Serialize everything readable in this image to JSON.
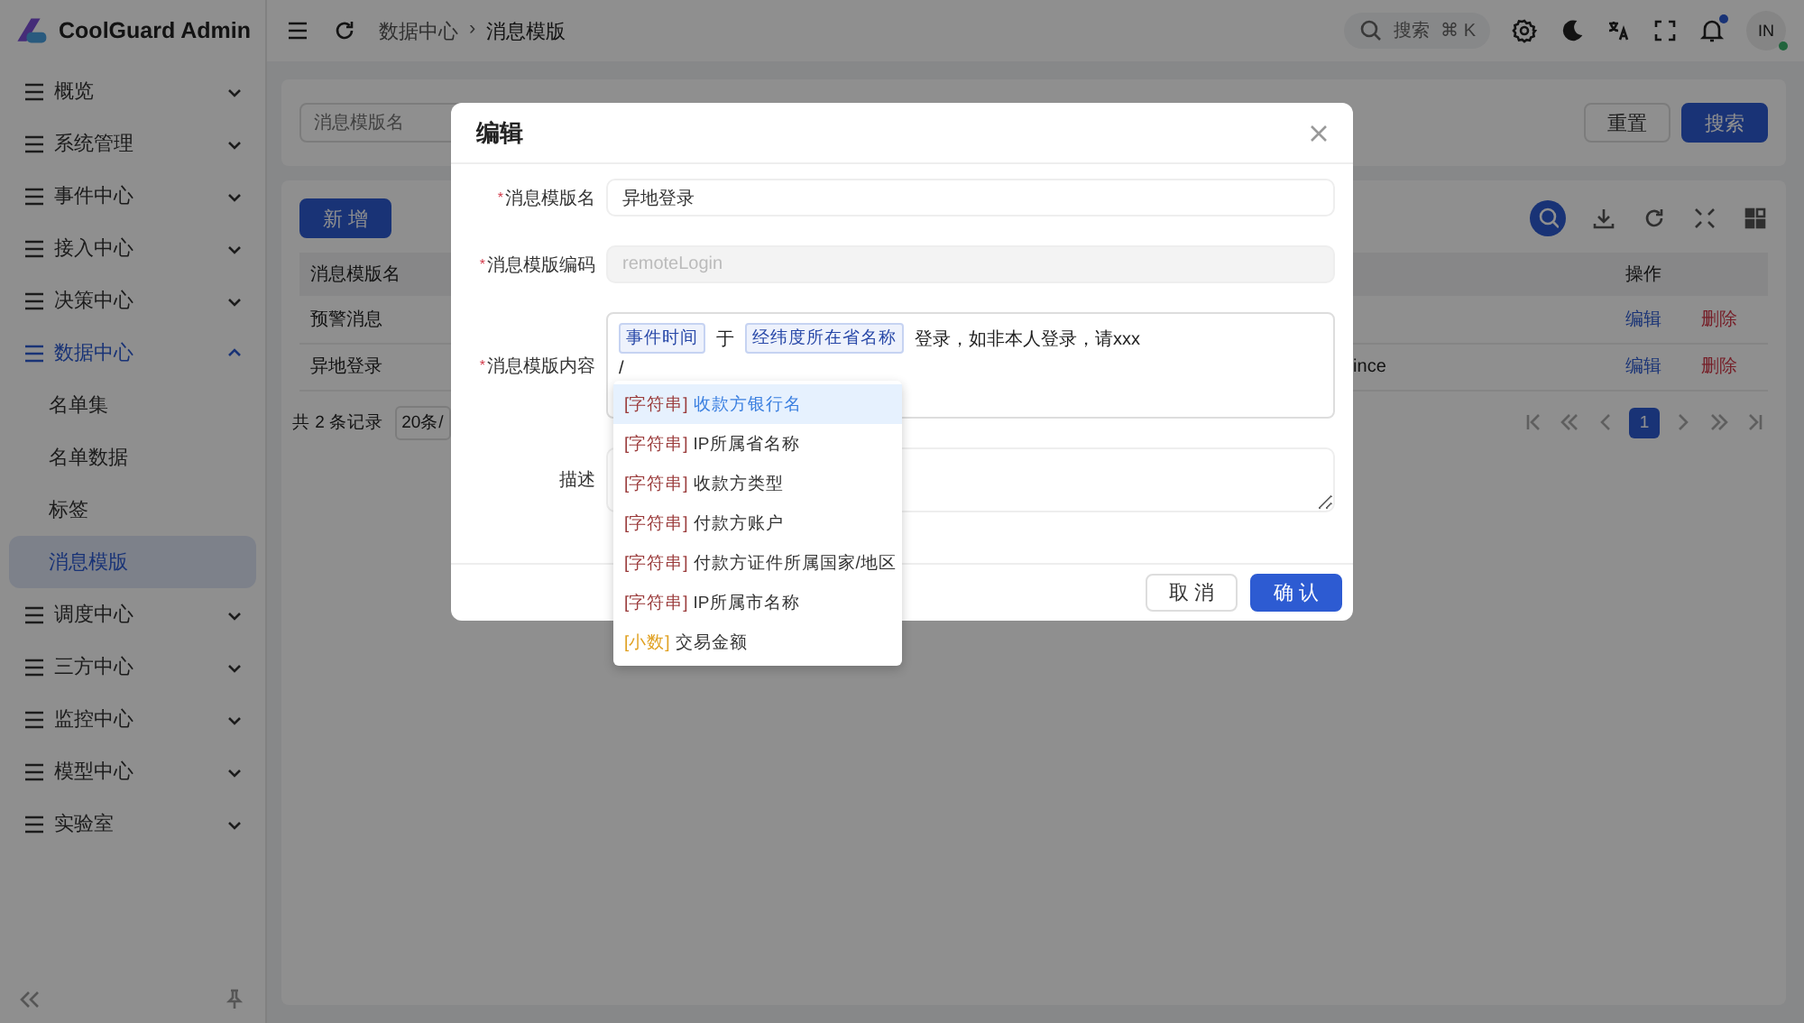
{
  "app": {
    "title": "CoolGuard Admin"
  },
  "sidebar": {
    "items": [
      {
        "label": "概览",
        "expanded": false,
        "selected": false
      },
      {
        "label": "系统管理",
        "expanded": false,
        "selected": false
      },
      {
        "label": "事件中心",
        "expanded": false,
        "selected": false
      },
      {
        "label": "接入中心",
        "expanded": false,
        "selected": false
      },
      {
        "label": "决策中心",
        "expanded": false,
        "selected": false
      },
      {
        "label": "数据中心",
        "expanded": true,
        "selected": true,
        "children": [
          {
            "label": "名单集",
            "selected": false
          },
          {
            "label": "名单数据",
            "selected": false
          },
          {
            "label": "标签",
            "selected": false
          },
          {
            "label": "消息模版",
            "selected": true
          }
        ]
      },
      {
        "label": "调度中心",
        "expanded": false,
        "selected": false
      },
      {
        "label": "三方中心",
        "expanded": false,
        "selected": false
      },
      {
        "label": "监控中心",
        "expanded": false,
        "selected": false
      },
      {
        "label": "模型中心",
        "expanded": false,
        "selected": false
      },
      {
        "label": "实验室",
        "expanded": false,
        "selected": false
      }
    ]
  },
  "header": {
    "breadcrumb": [
      "数据中心",
      "›",
      "消息模版"
    ],
    "search": {
      "placeholder": "搜索",
      "shortcut": "⌘ K"
    },
    "avatar": "IN",
    "notification_dot": true
  },
  "filter": {
    "placeholder": "消息模版名",
    "buttons": [
      {
        "label": "重置",
        "kind": "default"
      },
      {
        "label": "搜索",
        "kind": "primary"
      }
    ]
  },
  "toolbar": {
    "add_button": "新 增"
  },
  "table": {
    "columns": [
      "消息模版名",
      "操作"
    ],
    "rows": [
      {
        "cells": [
          "预警消息",
          ""
        ],
        "actions": [
          "编辑",
          "删除"
        ]
      },
      {
        "cells": [
          "异地登录",
          "ince"
        ],
        "actions": [
          "编辑",
          "删除"
        ]
      }
    ]
  },
  "pagination": {
    "total": "共 2 条记录",
    "page_size": "20条/",
    "pages": [
      {
        "label": "1",
        "selected": true
      }
    ]
  },
  "modal": {
    "title": "编辑",
    "fields": [
      {
        "label": "消息模版名",
        "required": true,
        "required_mark": "*",
        "kind": "input",
        "value": "异地登录",
        "disabled": false
      },
      {
        "label": "消息模版编码",
        "required": true,
        "required_mark": "*",
        "kind": "input",
        "value": "remoteLogin",
        "disabled": true
      },
      {
        "label": "消息模版内容",
        "required": true,
        "required_mark": "*",
        "kind": "template",
        "segments": [
          {
            "kind": "tag",
            "text": "事件时间"
          },
          {
            "kind": "text",
            "text": "于"
          },
          {
            "kind": "tag",
            "text": "经纬度所在省名称"
          },
          {
            "kind": "text",
            "text": "登录，如非本人登录，请xxx"
          }
        ],
        "typed": "/"
      },
      {
        "label": "描述",
        "required": false,
        "kind": "textarea"
      }
    ],
    "buttons": [
      {
        "label": "取 消",
        "kind": "default"
      },
      {
        "label": "确 认",
        "kind": "primary"
      }
    ]
  },
  "suggestions": [
    {
      "type": "[字符串]",
      "kind": "string",
      "label": "收款方银行名",
      "selected": true
    },
    {
      "type": "[字符串]",
      "kind": "string",
      "label": "IP所属省名称",
      "selected": false
    },
    {
      "type": "[字符串]",
      "kind": "string",
      "label": "收款方类型",
      "selected": false
    },
    {
      "type": "[字符串]",
      "kind": "string",
      "label": "付款方账户",
      "selected": false
    },
    {
      "type": "[字符串]",
      "kind": "string",
      "label": "付款方证件所属国家/地区",
      "selected": false
    },
    {
      "type": "[字符串]",
      "kind": "string",
      "label": "IP所属市名称",
      "selected": false
    },
    {
      "type": "[小数]",
      "kind": "decimal",
      "label": "交易金额",
      "selected": false
    }
  ]
}
